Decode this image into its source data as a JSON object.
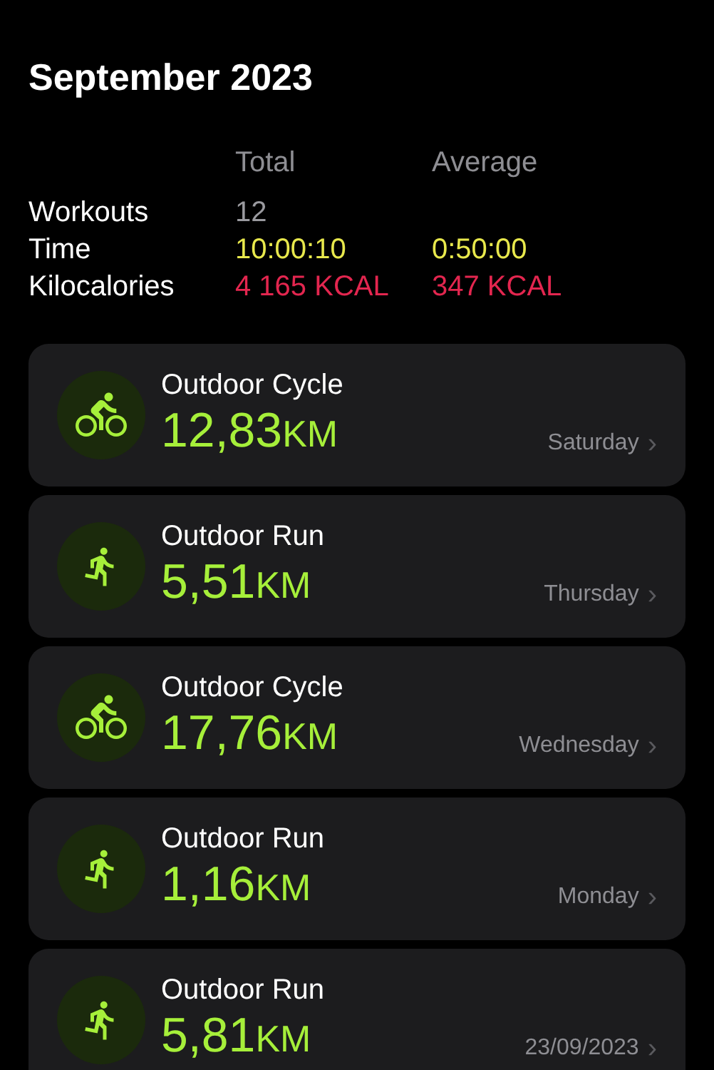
{
  "period": "September 2023",
  "summary": {
    "columns": [
      "Total",
      "Average"
    ],
    "rows": [
      {
        "label": "Workouts",
        "total": "12",
        "color": "#9a9a9f"
      },
      {
        "label": "Time",
        "total": "10:00:10",
        "average": "0:50:00",
        "color": "#e8e84c"
      },
      {
        "label": "Kilocalories",
        "total": "4 165 KCAL",
        "average": "347 KCAL",
        "color": "#e3264f"
      }
    ]
  },
  "workouts": [
    {
      "kind": "cycle",
      "name": "Outdoor Cycle",
      "distance": "12,83",
      "unit": "KM",
      "date": "Saturday",
      "chevron": "›"
    },
    {
      "kind": "run",
      "name": "Outdoor Run",
      "distance": "5,51",
      "unit": "KM",
      "date": "Thursday",
      "chevron": "›"
    },
    {
      "kind": "cycle",
      "name": "Outdoor Cycle",
      "distance": "17,76",
      "unit": "KM",
      "date": "Wednesday",
      "chevron": "›"
    },
    {
      "kind": "run",
      "name": "Outdoor Run",
      "distance": "1,16",
      "unit": "KM",
      "date": "Monday",
      "chevron": "›"
    },
    {
      "kind": "run",
      "name": "Outdoor Run",
      "distance": "5,81",
      "unit": "KM",
      "date": "23/09/2023",
      "chevron": "›"
    }
  ]
}
